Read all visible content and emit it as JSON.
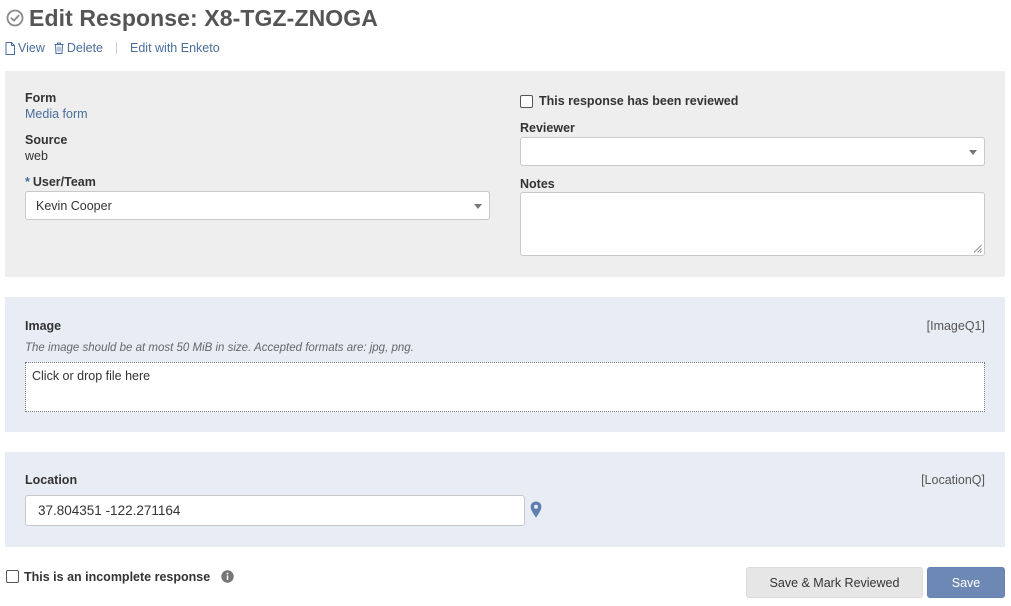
{
  "header": {
    "title": "Edit Response: X8-TGZ-ZNOGA",
    "title_icon": "check-circle-icon"
  },
  "actions": {
    "view": "View",
    "delete": "Delete",
    "edit_enketo": "Edit with Enketo"
  },
  "meta": {
    "form_label": "Form",
    "form_value": "Media form",
    "source_label": "Source",
    "source_value": "web",
    "user_team_required": "*",
    "user_team_label": "User/Team",
    "user_team_value": "Kevin Cooper",
    "reviewed_label": "This response has been reviewed",
    "reviewed_checked": false,
    "reviewer_label": "Reviewer",
    "reviewer_value": "",
    "notes_label": "Notes",
    "notes_value": ""
  },
  "questions": {
    "image": {
      "label": "Image",
      "code": "[ImageQ1]",
      "hint": "The image should be at most 50 MiB in size. Accepted formats are: jpg, png.",
      "dropzone_text": "Click or drop file here"
    },
    "location": {
      "label": "Location",
      "code": "[LocationQ]",
      "value": "37.804351 -122.271164",
      "icon": "map-marker-icon"
    }
  },
  "footer": {
    "incomplete_label": "This is an incomplete response",
    "incomplete_checked": false,
    "info_icon": "info-icon",
    "save_mark_reviewed": "Save & Mark Reviewed",
    "save": "Save"
  },
  "colors": {
    "link": "#4a6d9c",
    "primary_button": "#6e88b5",
    "question_panel": "#e8edf5",
    "meta_panel": "#eeeeee"
  }
}
